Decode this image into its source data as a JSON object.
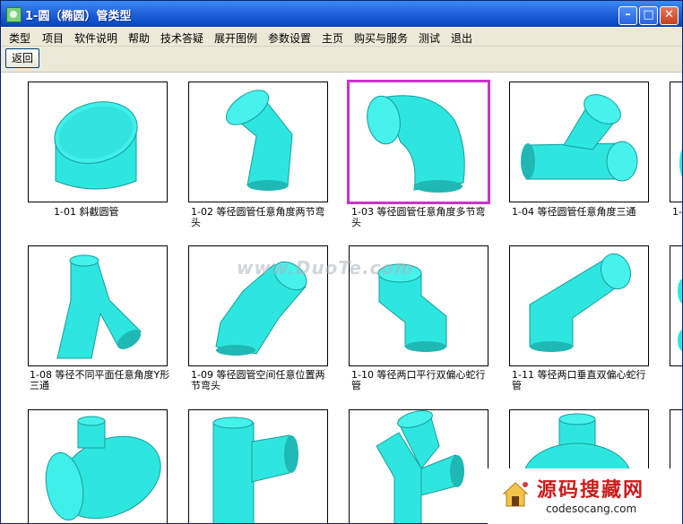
{
  "window": {
    "title": "1-圆（椭圆）管类型"
  },
  "menu": [
    "类型",
    "项目",
    "软件说明",
    "帮助",
    "技术答疑",
    "展开图例",
    "参数设置",
    "主页",
    "购买与服务",
    "测试",
    "退出"
  ],
  "toolbar": {
    "back_label": "返回"
  },
  "items": [
    {
      "caption": "1-01 斜截圆管",
      "selected": false
    },
    {
      "caption": "1-02 等径圆管任意角度两节弯头",
      "selected": false
    },
    {
      "caption": "1-03 等径圆管任意角度多节弯头",
      "selected": true
    },
    {
      "caption": "1-04 等径圆管任意角度三通",
      "selected": false
    },
    {
      "caption": "1-08 等径不同平面任意角度Y形三通",
      "selected": false
    },
    {
      "caption": "1-09 等径圆管空间任意位置两节弯头",
      "selected": false
    },
    {
      "caption": "1-10 等径两口平行双偏心蛇行管",
      "selected": false
    },
    {
      "caption": "1-11 等径两口垂直双偏心蛇行管",
      "selected": false
    }
  ],
  "partial_caption": "1-",
  "watermark": "www.DuoTe.com",
  "brand": {
    "title": "源码搜藏网",
    "url": "codesocang.com"
  },
  "colors": {
    "pipe": "#2ee6e0",
    "pipe_dark": "#1fb8b4",
    "selection": "#cc33cc"
  }
}
